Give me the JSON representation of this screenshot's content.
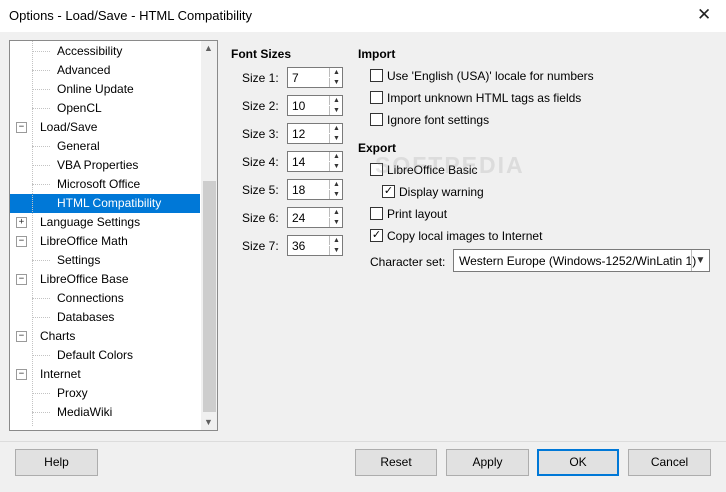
{
  "window": {
    "title": "Options - Load/Save - HTML Compatibility"
  },
  "tree": {
    "items": [
      {
        "label": "Accessibility",
        "level": 1
      },
      {
        "label": "Advanced",
        "level": 1
      },
      {
        "label": "Online Update",
        "level": 1
      },
      {
        "label": "OpenCL",
        "level": 1
      },
      {
        "label": "Load/Save",
        "level": 0,
        "expander": "⊟"
      },
      {
        "label": "General",
        "level": 1
      },
      {
        "label": "VBA Properties",
        "level": 1
      },
      {
        "label": "Microsoft Office",
        "level": 1
      },
      {
        "label": "HTML Compatibility",
        "level": 1,
        "selected": true
      },
      {
        "label": "Language Settings",
        "level": 0,
        "expander": "⊞"
      },
      {
        "label": "LibreOffice Math",
        "level": 0,
        "expander": "⊟"
      },
      {
        "label": "Settings",
        "level": 1
      },
      {
        "label": "LibreOffice Base",
        "level": 0,
        "expander": "⊟"
      },
      {
        "label": "Connections",
        "level": 1
      },
      {
        "label": "Databases",
        "level": 1
      },
      {
        "label": "Charts",
        "level": 0,
        "expander": "⊟"
      },
      {
        "label": "Default Colors",
        "level": 1
      },
      {
        "label": "Internet",
        "level": 0,
        "expander": "⊟"
      },
      {
        "label": "Proxy",
        "level": 1
      },
      {
        "label": "MediaWiki",
        "level": 1
      }
    ]
  },
  "font_sizes": {
    "heading": "Font Sizes",
    "sizes": [
      {
        "label": "Size 1:",
        "value": "7"
      },
      {
        "label": "Size 2:",
        "value": "10"
      },
      {
        "label": "Size 3:",
        "value": "12"
      },
      {
        "label": "Size 4:",
        "value": "14"
      },
      {
        "label": "Size 5:",
        "value": "18"
      },
      {
        "label": "Size 6:",
        "value": "24"
      },
      {
        "label": "Size 7:",
        "value": "36"
      }
    ]
  },
  "import": {
    "heading": "Import",
    "options": [
      {
        "label": "Use 'English (USA)' locale for numbers",
        "checked": false
      },
      {
        "label": "Import unknown HTML tags as fields",
        "checked": false
      },
      {
        "label": "Ignore font settings",
        "checked": false
      }
    ]
  },
  "export": {
    "heading": "Export",
    "libreoffice_basic": {
      "label": "LibreOffice Basic",
      "checked": false
    },
    "display_warning": {
      "label": "Display warning",
      "checked": true
    },
    "print_layout": {
      "label": "Print layout",
      "checked": false
    },
    "copy_images": {
      "label": "Copy local images to Internet",
      "checked": true
    },
    "charset_label": "Character set:",
    "charset_value": "Western Europe (Windows-1252/WinLatin 1)"
  },
  "watermark": "SOFTPEDIA",
  "buttons": {
    "help": "Help",
    "reset": "Reset",
    "apply": "Apply",
    "ok": "OK",
    "cancel": "Cancel"
  },
  "colors": {
    "selection": "#0078d7",
    "default_button_border": "#0078d7"
  },
  "icons": {
    "close": "close-icon",
    "expanded": "collapse-box-icon",
    "collapsed": "expand-box-icon",
    "spin_up": "chevron-up-icon",
    "spin_down": "chevron-down-icon",
    "combo_drop": "chevron-down-icon",
    "check": "check-icon"
  }
}
